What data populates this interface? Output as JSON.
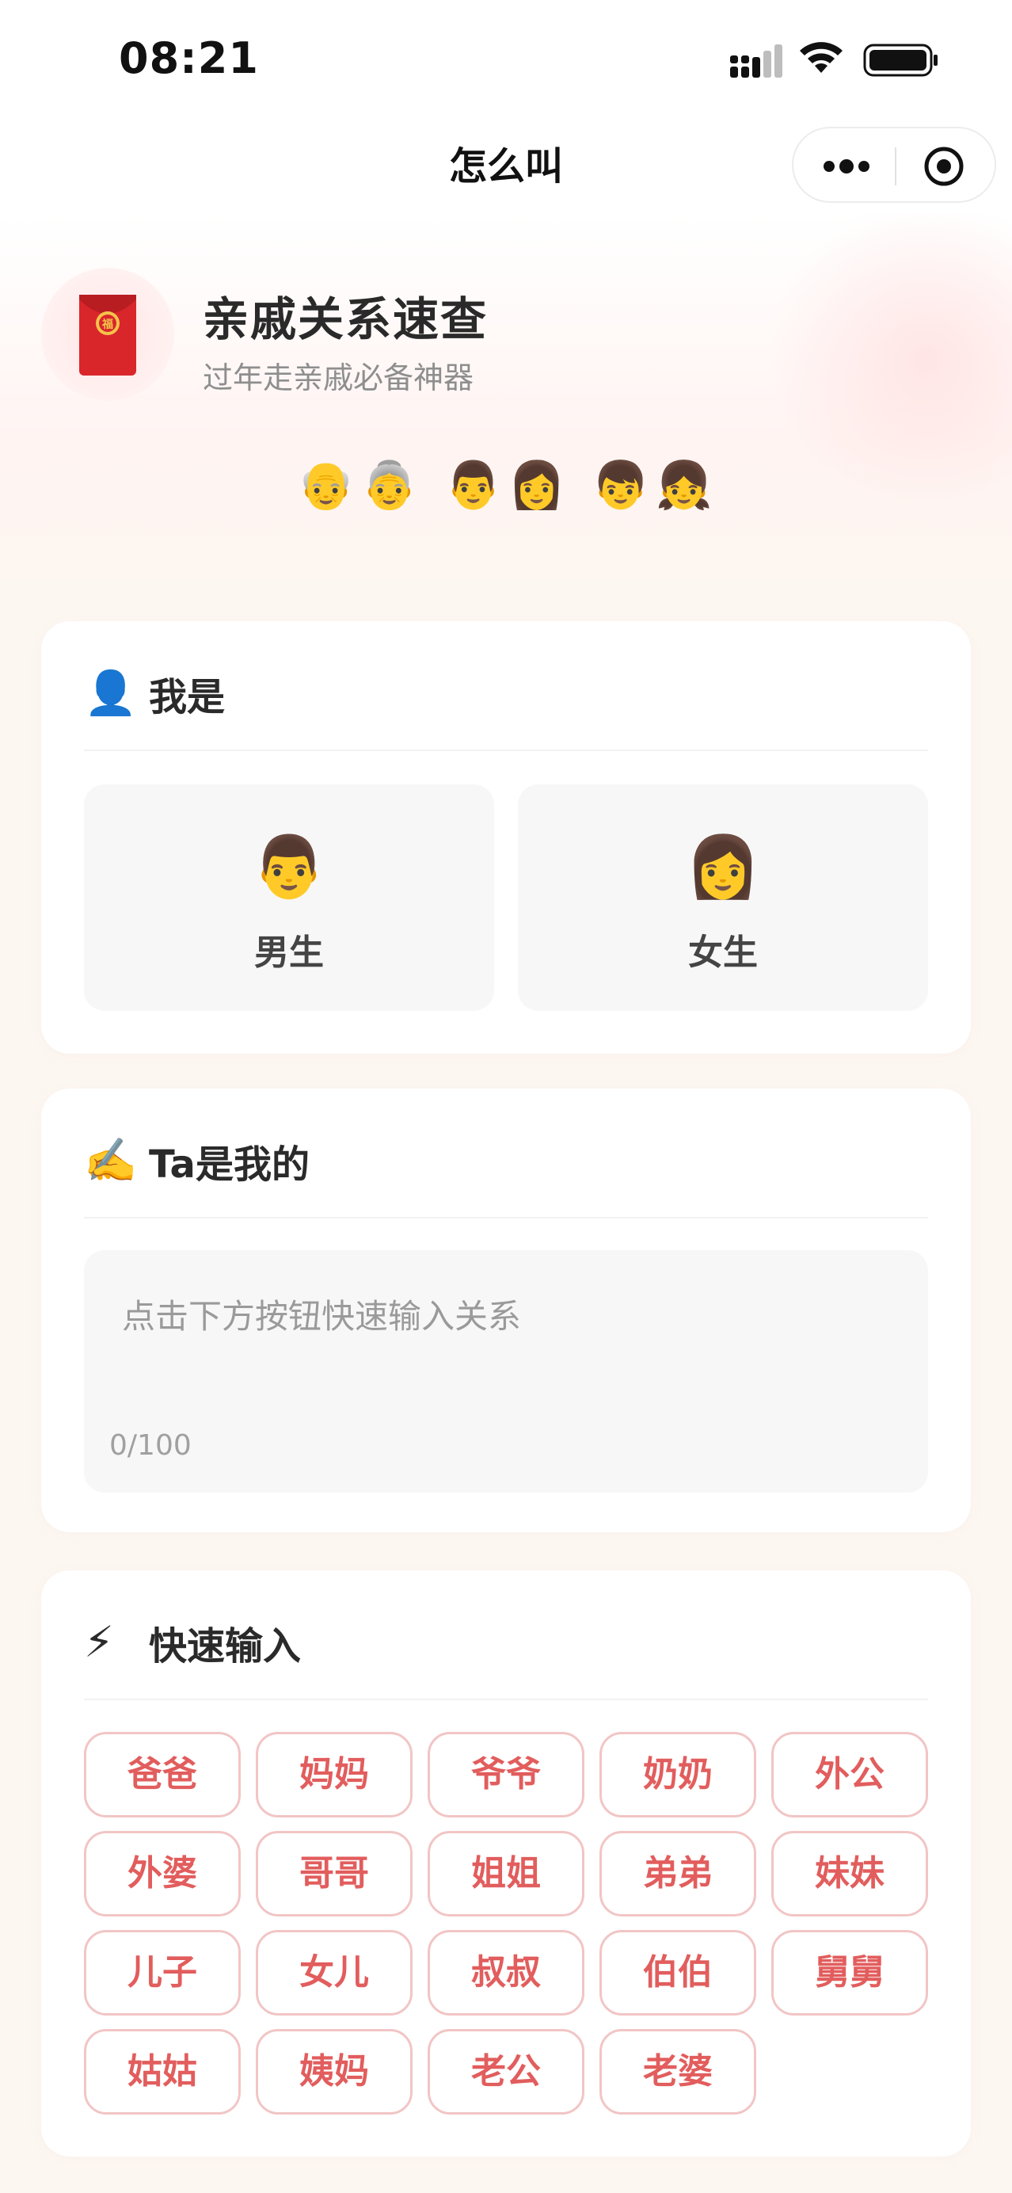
{
  "status_bar": {
    "time": "08:21"
  },
  "nav": {
    "title": "怎么叫"
  },
  "header": {
    "title": "亲戚关系速查",
    "subtitle": "过年走亲戚必备神器",
    "family_emojis": [
      "👴",
      "👵",
      "👨",
      "👩",
      "👦",
      "👧"
    ]
  },
  "gender_card": {
    "icon": "👤",
    "title": "我是",
    "options": [
      {
        "emoji": "👨",
        "label": "男生"
      },
      {
        "emoji": "👩",
        "label": "女生"
      }
    ]
  },
  "relation_card": {
    "icon": "✍️",
    "title": "Ta是我的",
    "placeholder": "点击下方按钮快速输入关系",
    "counter": "0/100"
  },
  "quick_card": {
    "icon": "⚡",
    "title": "快速输入",
    "chips": [
      "爸爸",
      "妈妈",
      "爷爷",
      "奶奶",
      "外公",
      "外婆",
      "哥哥",
      "姐姐",
      "弟弟",
      "妹妹",
      "儿子",
      "女儿",
      "叔叔",
      "伯伯",
      "舅舅",
      "姑姑",
      "姨妈",
      "老公",
      "老婆"
    ]
  },
  "colors": {
    "accent_red": "#e25d5d",
    "chip_border": "#f2c5c5",
    "background": "#fdf7f2"
  }
}
